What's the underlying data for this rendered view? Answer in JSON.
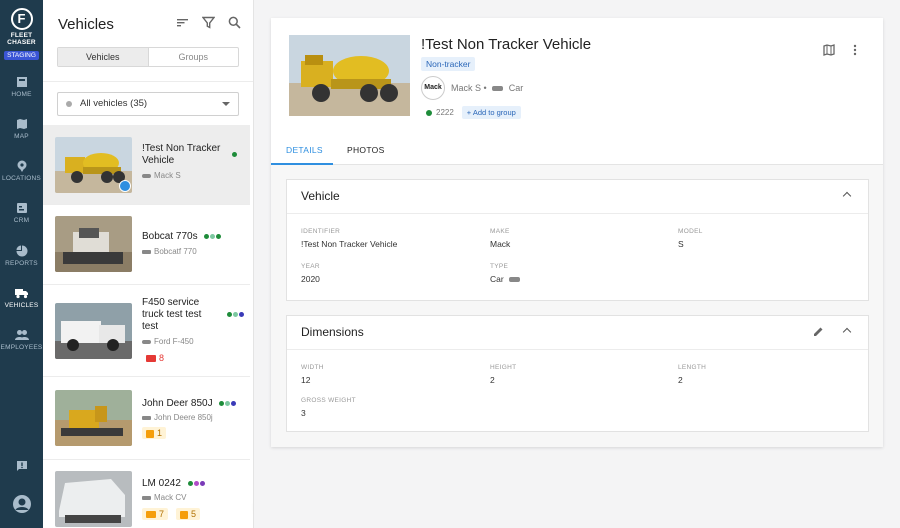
{
  "brand": {
    "line1": "FLEET",
    "line2": "CHASER",
    "env": "STAGING",
    "mark": "F"
  },
  "nav": [
    {
      "label": "HOME",
      "icon": "home-icon"
    },
    {
      "label": "MAP",
      "icon": "map-icon"
    },
    {
      "label": "LOCATIONS",
      "icon": "location-pin-icon"
    },
    {
      "label": "CRM",
      "icon": "crm-icon"
    },
    {
      "label": "REPORTS",
      "icon": "pie-chart-icon"
    },
    {
      "label": "VEHICLES",
      "icon": "truck-icon"
    },
    {
      "label": "EMPLOYEES",
      "icon": "people-icon"
    }
  ],
  "list": {
    "title": "Vehicles",
    "segments": [
      "Vehicles",
      "Groups"
    ],
    "filter": "All vehicles (35)",
    "items": [
      {
        "name1": "!Test Non Tracker",
        "name2": "Vehicle",
        "sub": "Mack S"
      },
      {
        "name1": "Bobcat 770s",
        "sub": "Bobcatf 770"
      },
      {
        "name1": "F450 service",
        "name2": "truck test test",
        "name3": "test",
        "sub": "Ford F-450",
        "badge": "8"
      },
      {
        "name1": "John Deer 850J",
        "sub": "John Deere 850j",
        "badge": "1"
      },
      {
        "name1": "LM 0242",
        "sub": "Mack CV",
        "badge_a": "7",
        "badge_b": "5"
      }
    ],
    "fab": "+"
  },
  "detail": {
    "title": "!Test Non Tracker Vehicle",
    "chip": "Non-tracker",
    "make_logo": "Mack",
    "make_model": "Mack S •",
    "type": "Car",
    "identifier": "2222",
    "add_group": "+ Add to group",
    "tabs": [
      "DETAILS",
      "PHOTOS"
    ],
    "vehicle": {
      "heading": "Vehicle",
      "identifier_label": "IDENTIFIER",
      "identifier": "!Test Non Tracker Vehicle",
      "make_label": "MAKE",
      "make": "Mack",
      "model_label": "MODEL",
      "model": "S",
      "year_label": "YEAR",
      "year": "2020",
      "type_label": "TYPE",
      "type": "Car"
    },
    "dimensions": {
      "heading": "Dimensions",
      "width_label": "WIDTH",
      "width": "12",
      "height_label": "HEIGHT",
      "height": "2",
      "length_label": "LENGTH",
      "length": "2",
      "gross_label": "GROSS WEIGHT",
      "gross": "3"
    }
  },
  "colors": {
    "rail": "#1f3b4d",
    "accent": "#2f8fe0",
    "green": "#1e8c3a",
    "red": "#e53935",
    "amber": "#f59e0b"
  }
}
